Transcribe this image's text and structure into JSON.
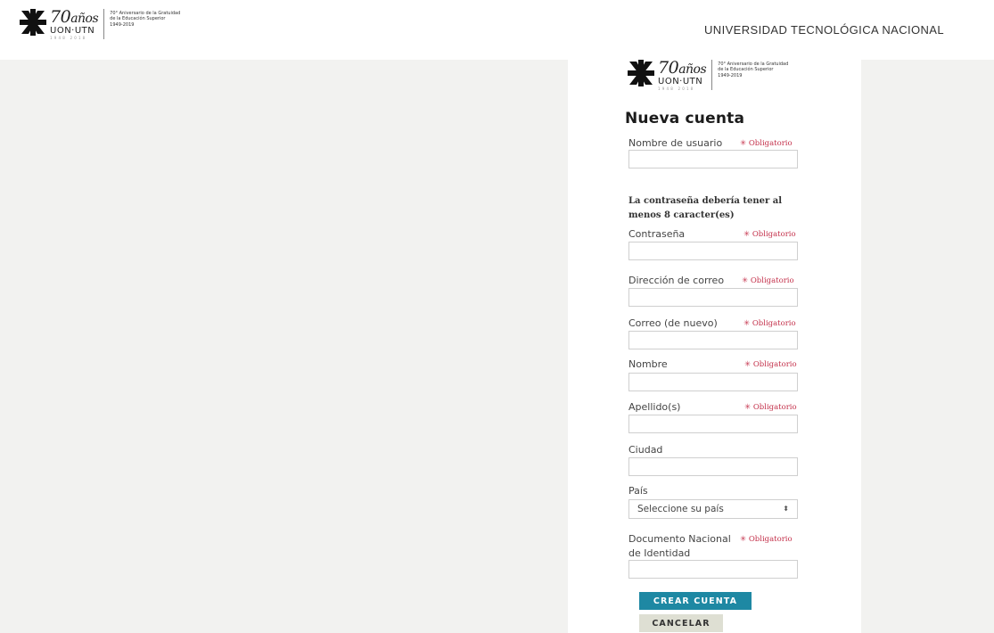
{
  "header": {
    "logo": {
      "number": "70",
      "anos": "años",
      "uon": "UON·UTN",
      "years": "1948 2018",
      "caption_lines": [
        "70° Aniversario de la Gratuidad",
        "de la Educación Superior",
        "1949-2019"
      ]
    },
    "university_name": "UNIVERSIDAD TECNOLÓGICA NACIONAL"
  },
  "form": {
    "title": "Nueva cuenta",
    "required_text": "Obligatorio",
    "password_note": "La contraseña debería tener al menos 8 caracter(es)",
    "fields": {
      "username": {
        "label": "Nombre de usuario",
        "value": ""
      },
      "password": {
        "label": "Contraseña",
        "value": ""
      },
      "email": {
        "label": "Dirección de correo",
        "value": ""
      },
      "email_again": {
        "label": "Correo (de nuevo)",
        "value": ""
      },
      "first_name": {
        "label": "Nombre",
        "value": ""
      },
      "last_name": {
        "label": "Apellido(s)",
        "value": ""
      },
      "city": {
        "label": "Ciudad",
        "value": ""
      },
      "country": {
        "label": "País",
        "selected": "Seleccione su país"
      },
      "id_document": {
        "label_line1": "Documento Nacional",
        "label_line2": "de Identidad",
        "value": ""
      }
    },
    "buttons": {
      "create": "CREAR CUENTA",
      "cancel": "CANCELAR"
    }
  },
  "colors": {
    "accent": "#1e88a3",
    "required": "#c4314b",
    "page_background": "#f2f2f0",
    "cancel_button": "#dedfd3"
  }
}
